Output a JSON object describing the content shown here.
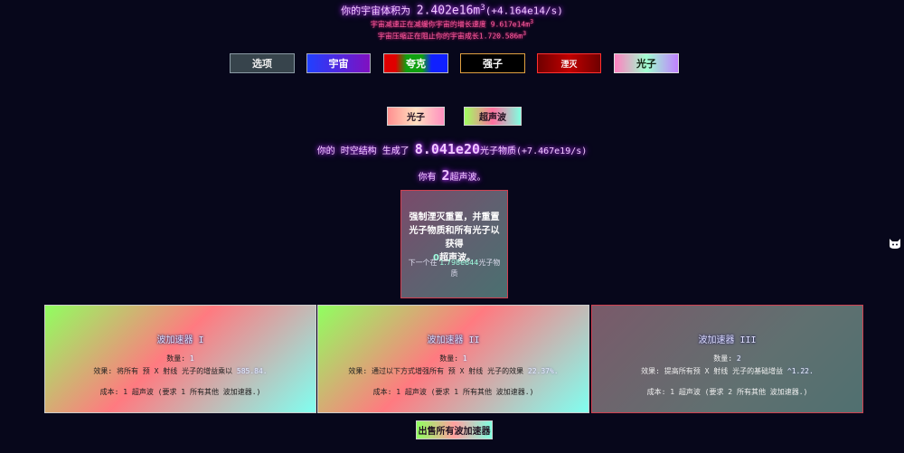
{
  "header": {
    "volume_prefix": "你的宇宙体积为",
    "volume_value": "2.402e16m",
    "volume_exp": "3",
    "volume_rate": "(+4.164e14/s)",
    "slowdown_text": "宇宙减速正在减缓你宇宙的增长速度 9.617e14m",
    "slowdown_exp": "3",
    "stop_text": "宇宙压缩正在阻止你的宇宙成长1.720.586m",
    "stop_exp": "3"
  },
  "tabs": {
    "options": "选项",
    "universe": "宇宙",
    "quark": "夸克",
    "hadron": "强子",
    "annihilation": "湮灭",
    "photon": "光子"
  },
  "subtabs": {
    "photons": "光子",
    "ultrasound": "超声波"
  },
  "generation": {
    "prefix": "你的 时空结构 生成了",
    "value": "8.041e20",
    "suffix": "光子物质(+7.467e19/s)"
  },
  "have": {
    "prefix": "你有",
    "value": "2",
    "suffix": "超声波。"
  },
  "reset": {
    "main_text": "强制湮灭重置，并重置光子物质和所有光子以获得",
    "gain_value": "0",
    "gain_suffix": "超声波。",
    "next_prefix": "下一个在",
    "next_value": "1.798e644",
    "next_suffix": "光子物质"
  },
  "upgrades": [
    {
      "title": "波加速器 I",
      "amount_label": "数量:",
      "amount_value": "1",
      "effect_text": "效果: 将所有 预 X 射线 光子的增益乘以",
      "effect_value": "585.84.",
      "cost_text": "成本: 1 超声波 (要求 1 所有其他 波加速器.)"
    },
    {
      "title": "波加速器 II",
      "amount_label": "数量:",
      "amount_value": "1",
      "effect_text": "效果: 通过以下方式增强所有 预 X 射线 光子的效果",
      "effect_value": "22.37%.",
      "cost_text": "成本: 1 超声波 (要求 1 所有其他 波加速器.)"
    },
    {
      "title": "波加速器 III",
      "amount_label": "数量:",
      "amount_value": "2",
      "effect_text": "效果: 提高所有预 X 射线 光子的基础增益",
      "effect_value": "^1.22.",
      "cost_text": "成本: 1 超声波 (要求 2 所有其他 波加速器.)"
    }
  ],
  "sell_all": "出售所有波加速器",
  "side_icon": "cat-icon"
}
